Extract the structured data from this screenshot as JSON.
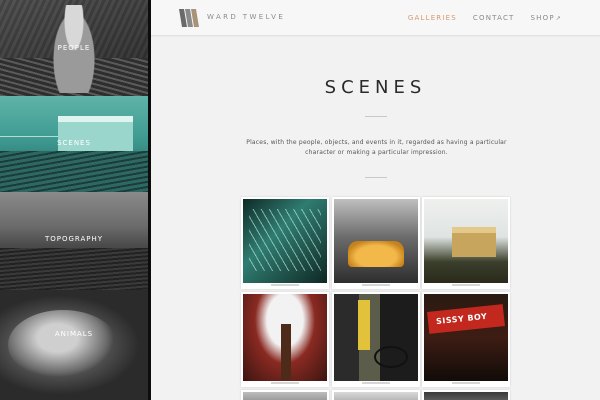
{
  "brand": {
    "name": "WARD TWELVE"
  },
  "nav": {
    "items": [
      {
        "label": "GALLERIES",
        "active": true
      },
      {
        "label": "CONTACT",
        "active": false
      },
      {
        "label": "SHOP",
        "active": false,
        "external": true
      }
    ],
    "active_color": "#d39a6e"
  },
  "sidebar": {
    "tiles": [
      {
        "label": "PEOPLE"
      },
      {
        "label": "SCENES",
        "active": true,
        "tint": "#3e9a91"
      },
      {
        "label": "TOPOGRAPHY"
      },
      {
        "label": "ANIMALS"
      }
    ]
  },
  "page": {
    "title": "SCENES",
    "description": "Places, with the people, objects, and events in it, regarded as having a particular character or making a particular impression."
  },
  "gallery": {
    "thumbnails": [
      {
        "subject": "station-icon"
      },
      {
        "subject": "car-icon"
      },
      {
        "subject": "shed-icon"
      },
      {
        "subject": "tree-icon"
      },
      {
        "subject": "bicycle-icon"
      },
      {
        "subject": "sign-icon",
        "sign_text": "SISSY BOY"
      },
      {
        "subject": "photo-icon"
      },
      {
        "subject": "photo-icon"
      },
      {
        "subject": "photo-icon"
      }
    ]
  }
}
